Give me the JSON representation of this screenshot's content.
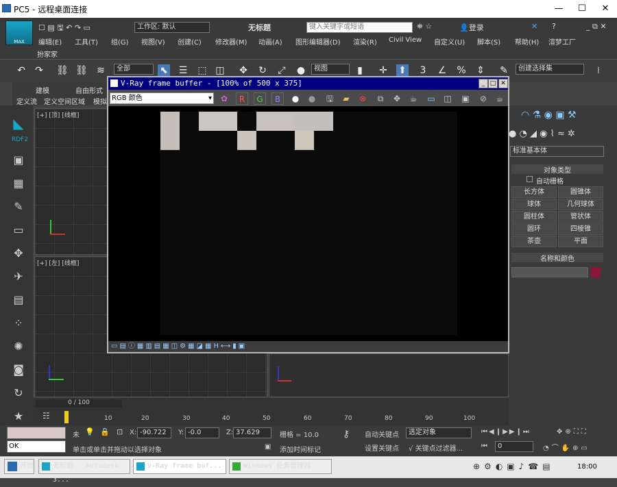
{
  "rdp": {
    "title": "PC5 - 远程桌面连接",
    "min": "—",
    "max": "☐",
    "close": "✕"
  },
  "max": {
    "logo": "MAX",
    "workspace_label": "工作区: 默认",
    "doc_title": "无标题",
    "search_placeholder": "键入关键字或短语",
    "login": "登录",
    "menus": [
      "编辑(E)",
      "工具(T)",
      "组(G)",
      "视图(V)",
      "创建(C)",
      "修改器(M)",
      "动画(A)",
      "图形编辑器(D)",
      "渲染(R)",
      "Civil View",
      "自定义(U)",
      "脚本(S)",
      "帮助(H)",
      "渲梦工厂"
    ],
    "menu2": "扮家家",
    "toolbar": {
      "filter": "全部",
      "view": "视图",
      "selset": "创建选择集",
      "num3": "3"
    },
    "ribbon": {
      "t1": "建模",
      "t2": "自由形式",
      "t3": "定义流",
      "t4": "定义空间区域",
      "t5": "模拟"
    },
    "left_label": "RDF2"
  },
  "viewports": {
    "top": "[+] [顶] [线框]",
    "left": "[+] [左] [线框]"
  },
  "rpanel": {
    "dropdown": "标准基本体",
    "obj_type": "对象类型",
    "autogrid": "自动栅格",
    "buttons": [
      "长方体",
      "圆锥体",
      "球体",
      "几何球体",
      "圆柱体",
      "管状体",
      "圆环",
      "四棱锥",
      "茶壶",
      "平面"
    ],
    "name_color": "名称和颜色",
    "swatch": "#8b1538"
  },
  "vray": {
    "title": "V-Ray frame buffer - [100% of 500 x 375]",
    "channel": "RGB 颜色",
    "r": "R",
    "g": "G",
    "b": "B"
  },
  "timeline": {
    "frame": "0 / 100",
    "ticks": [
      "10",
      "20",
      "30",
      "40",
      "50",
      "60",
      "70",
      "80",
      "90",
      "100"
    ]
  },
  "status": {
    "x_label": "X:",
    "x": "-90.722",
    "y_label": "Y:",
    "y": "-0.0",
    "z_label": "Z:",
    "z": "37.629",
    "grid": "栅格 = 10.0",
    "autokey": "自动关键点",
    "sel": "选定对象",
    "setkey": "设置关键点",
    "filters": "关键点过滤器...",
    "addtime": "添加时间标记",
    "prompt": "单击或单击并拖动以选择对象",
    "ok": "OK",
    "frame": "0",
    "lock_label": "未"
  },
  "taskbar": {
    "start": "开始",
    "tasks": [
      "无标题 - Autodesk 3...",
      "V-Ray frame buf...",
      "Windows 任务管理器"
    ],
    "time": "18:00"
  }
}
